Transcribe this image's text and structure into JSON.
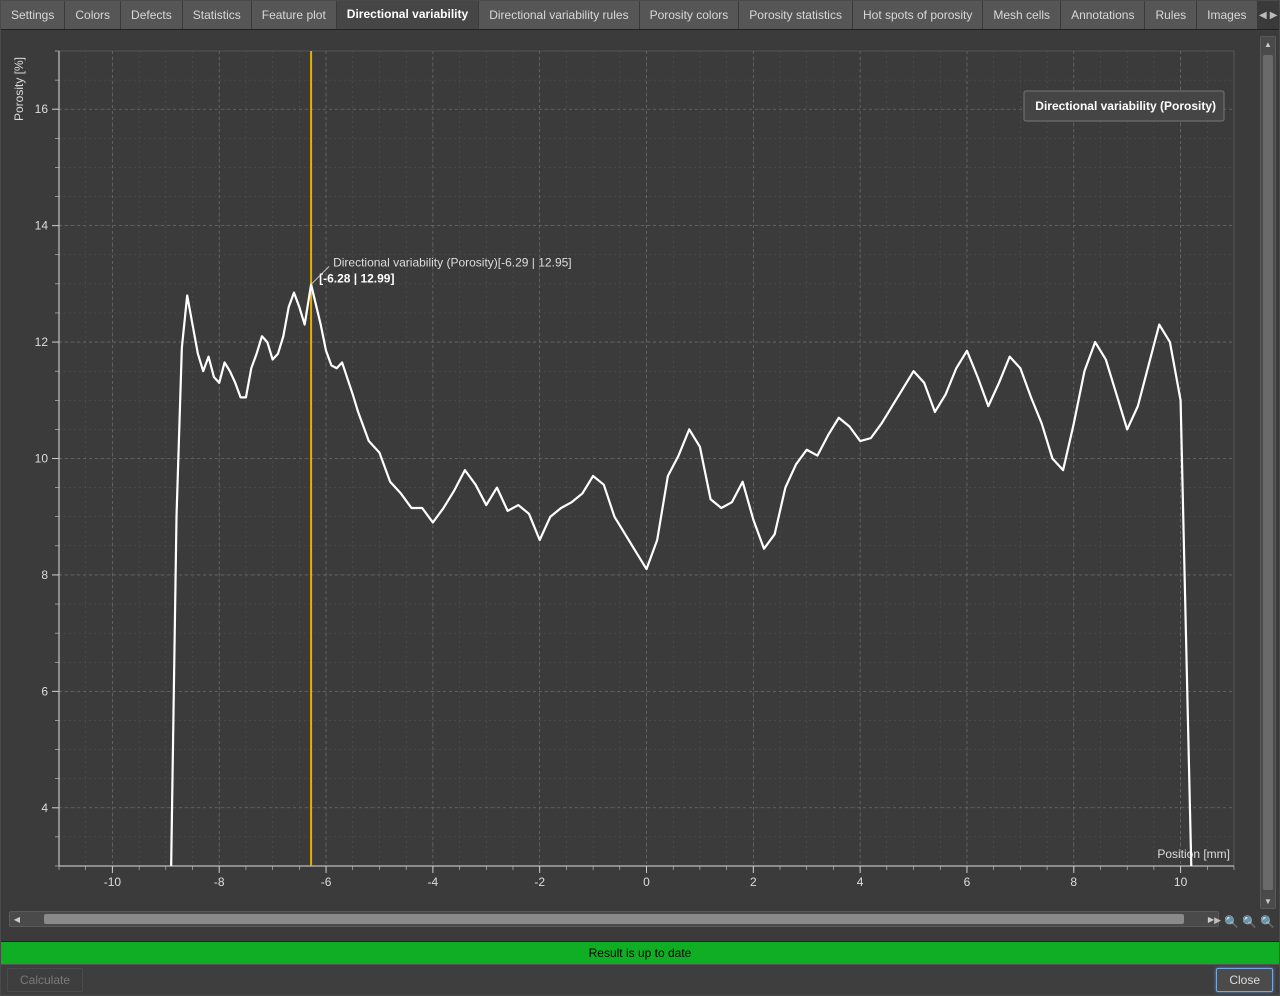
{
  "tabs": [
    "Settings",
    "Colors",
    "Defects",
    "Statistics",
    "Feature plot",
    "Directional variability",
    "Directional variability rules",
    "Porosity colors",
    "Porosity statistics",
    "Hot spots of porosity",
    "Mesh cells",
    "Annotations",
    "Rules",
    "Images"
  ],
  "active_tab_index": 5,
  "legend": "Directional variability (Porosity)",
  "cursor_label_top": "Directional variability (Porosity)[-6.29 | 12.95]",
  "cursor_label_bottom": "[-6.28 | 12.99]",
  "status": "Result is up to date",
  "buttons": {
    "calculate": "Calculate",
    "close": "Close"
  },
  "chart_data": {
    "type": "line",
    "title": "",
    "xlabel": "Position [mm]",
    "ylabel": "Porosity [%]",
    "xlim": [
      -11,
      11
    ],
    "ylim": [
      3,
      17
    ],
    "x_ticks": [
      -10,
      -8,
      -6,
      -4,
      -2,
      0,
      2,
      4,
      6,
      8,
      10
    ],
    "y_ticks": [
      4,
      6,
      8,
      10,
      12,
      14,
      16
    ],
    "cursor_x": -6.28,
    "series": [
      {
        "name": "Directional variability (Porosity)",
        "x": [
          -8.9,
          -8.8,
          -8.7,
          -8.6,
          -8.5,
          -8.4,
          -8.3,
          -8.2,
          -8.1,
          -8.0,
          -7.9,
          -7.8,
          -7.7,
          -7.6,
          -7.5,
          -7.4,
          -7.3,
          -7.2,
          -7.1,
          -7.0,
          -6.9,
          -6.8,
          -6.7,
          -6.6,
          -6.5,
          -6.4,
          -6.28,
          -6.1,
          -6.0,
          -5.9,
          -5.8,
          -5.7,
          -5.5,
          -5.4,
          -5.2,
          -5.0,
          -4.8,
          -4.6,
          -4.4,
          -4.2,
          -4.0,
          -3.8,
          -3.6,
          -3.4,
          -3.2,
          -3.0,
          -2.8,
          -2.6,
          -2.4,
          -2.2,
          -2.0,
          -1.8,
          -1.6,
          -1.4,
          -1.2,
          -1.0,
          -0.8,
          -0.6,
          -0.4,
          -0.2,
          0.0,
          0.2,
          0.4,
          0.6,
          0.8,
          1.0,
          1.2,
          1.4,
          1.6,
          1.8,
          2.0,
          2.2,
          2.4,
          2.6,
          2.8,
          3.0,
          3.2,
          3.4,
          3.6,
          3.8,
          4.0,
          4.2,
          4.4,
          4.6,
          4.8,
          5.0,
          5.2,
          5.4,
          5.6,
          5.8,
          6.0,
          6.2,
          6.4,
          6.6,
          6.8,
          7.0,
          7.2,
          7.4,
          7.6,
          7.8,
          8.0,
          8.2,
          8.4,
          8.6,
          8.8,
          9.0,
          9.2,
          9.4,
          9.6,
          9.8,
          10.0,
          10.1,
          10.2
        ],
        "y": [
          3.0,
          9.0,
          11.9,
          12.8,
          12.3,
          11.8,
          11.5,
          11.75,
          11.4,
          11.3,
          11.65,
          11.5,
          11.3,
          11.05,
          11.05,
          11.55,
          11.8,
          12.1,
          12.0,
          11.7,
          11.8,
          12.1,
          12.6,
          12.85,
          12.6,
          12.3,
          12.99,
          12.3,
          11.85,
          11.6,
          11.55,
          11.65,
          11.1,
          10.8,
          10.3,
          10.1,
          9.6,
          9.4,
          9.15,
          9.15,
          8.9,
          9.15,
          9.45,
          9.8,
          9.55,
          9.2,
          9.5,
          9.1,
          9.2,
          9.05,
          8.6,
          9.0,
          9.15,
          9.25,
          9.4,
          9.7,
          9.55,
          9.0,
          8.7,
          8.4,
          8.1,
          8.6,
          9.7,
          10.05,
          10.5,
          10.2,
          9.3,
          9.15,
          9.25,
          9.6,
          8.95,
          8.45,
          8.7,
          9.5,
          9.9,
          10.15,
          10.05,
          10.4,
          10.7,
          10.55,
          10.3,
          10.35,
          10.6,
          10.9,
          11.2,
          11.5,
          11.3,
          10.8,
          11.1,
          11.55,
          11.85,
          11.4,
          10.9,
          11.3,
          11.75,
          11.55,
          11.05,
          10.6,
          10.0,
          9.8,
          10.6,
          11.5,
          12.0,
          11.7,
          11.1,
          10.5,
          10.9,
          11.6,
          12.3,
          12.0,
          11.0,
          7.0,
          3.0
        ]
      }
    ]
  }
}
